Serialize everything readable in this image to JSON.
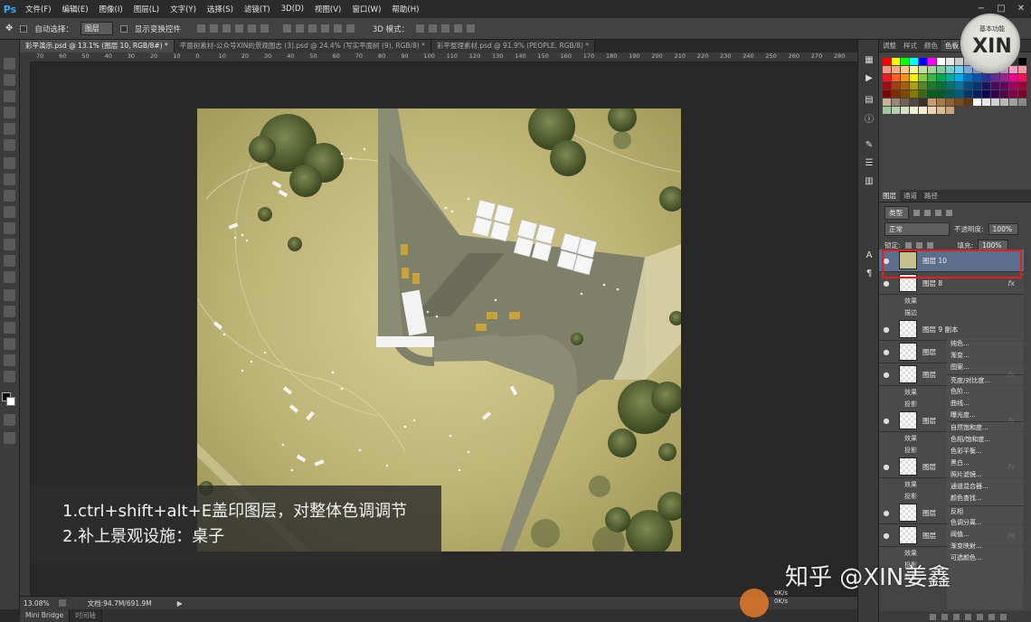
{
  "app": {
    "logo": "Ps"
  },
  "menu": [
    "文件(F)",
    "编辑(E)",
    "图像(I)",
    "图层(L)",
    "文字(Y)",
    "选择(S)",
    "滤镜(T)",
    "3D(D)",
    "视图(V)",
    "窗口(W)",
    "帮助(H)"
  ],
  "window_controls": [
    "−",
    "□",
    "✕"
  ],
  "options_bar": {
    "auto_select_label": "自动选择：",
    "auto_select_value": "图层",
    "show_transform_label": "显示变换控件",
    "mode_3d_label": "3D 模式：",
    "workspace": "基本功能"
  },
  "tabs": [
    {
      "label": "彩平演示.psd @ 13.1% (图层 10, RGB/8#) *",
      "active": true
    },
    {
      "label": "平面树素材-公众号XIN的景观图志 (3).psd @ 24.4% (写实平面树 (9), RGB/8) *",
      "active": false
    },
    {
      "label": "彩平整理素材.psd @ 91.9% (PEOPLE, RGB/8) *",
      "active": false
    }
  ],
  "ruler_ticks": [
    "70",
    "60",
    "50",
    "40",
    "30",
    "20",
    "10",
    "0",
    "10",
    "20",
    "30",
    "40",
    "50",
    "60",
    "70",
    "80",
    "90",
    "100",
    "110",
    "120",
    "130",
    "140",
    "150",
    "160",
    "170",
    "180",
    "190",
    "200",
    "210",
    "220",
    "230",
    "240",
    "250",
    "260",
    "270",
    "280"
  ],
  "subtitle": {
    "line1": "1.ctrl+shift+alt+E盖印图层，对整体色调调节",
    "line2": "2.补上景观设施：桌子"
  },
  "status": {
    "zoom": "13.08%",
    "doc": "文档:94.7M/691.9M"
  },
  "bottom_tabs": [
    "Mini Bridge",
    "时间轴"
  ],
  "swatch_panel": {
    "tabs": [
      "调整",
      "样式",
      "颜色",
      "色板"
    ]
  },
  "swatch_colors": [
    "#ff0000",
    "#ffff00",
    "#00ff00",
    "#00ffff",
    "#0000ff",
    "#ff00ff",
    "#ffffff",
    "#e6e6e6",
    "#cccccc",
    "#b3b3b3",
    "#999999",
    "#808080",
    "#666666",
    "#4d4d4d",
    "#333333",
    "#000000",
    "#f7977a",
    "#f9ad81",
    "#fdc68a",
    "#fff79a",
    "#c4df9b",
    "#a3d39c",
    "#82ca9d",
    "#7bcdc8",
    "#6ecff6",
    "#7ea7d8",
    "#8493ca",
    "#8882be",
    "#a187be",
    "#bc8dbf",
    "#f49ac2",
    "#f6989d",
    "#ed1c24",
    "#f26522",
    "#f7941d",
    "#fff200",
    "#8dc63f",
    "#39b54a",
    "#00a651",
    "#00a99d",
    "#00aeef",
    "#0072bc",
    "#0054a6",
    "#2e3192",
    "#662d91",
    "#92278f",
    "#ec008c",
    "#ed145b",
    "#9e0b0f",
    "#a0410d",
    "#a36209",
    "#aba000",
    "#598527",
    "#1a7b30",
    "#007236",
    "#00746b",
    "#0076a3",
    "#004b80",
    "#003471",
    "#1b1464",
    "#440e62",
    "#630460",
    "#9e005d",
    "#9e0039",
    "#790000",
    "#7b2e00",
    "#7d4900",
    "#827b00",
    "#406618",
    "#005e20",
    "#005826",
    "#005952",
    "#005b7f",
    "#003663",
    "#002157",
    "#0d004c",
    "#32004b",
    "#4b0049",
    "#7b0046",
    "#7a0026",
    "#c7b299",
    "#998675",
    "#736357",
    "#534741",
    "#37302d",
    "#c69c6d",
    "#a67c52",
    "#8c6239",
    "#754c24",
    "#603913",
    "#ffffff",
    "#e8e8e8",
    "#d0d0d0",
    "#b8b8b8",
    "#a0a0a0",
    "#888888",
    "#9fc7a0",
    "#b5d2b0",
    "#d6e3c4",
    "#eef0d6",
    "#f5ecd2",
    "#e9d7b9",
    "#d9bd97",
    "#c8a27a"
  ],
  "layers_panel": {
    "tabs": [
      "图层",
      "通道",
      "路径"
    ],
    "filter_kind": "类型",
    "blend_mode": "正常",
    "opacity_label": "不透明度:",
    "opacity_value": "100%",
    "lock_label": "锁定:",
    "fill_label": "填充:",
    "fill_value": "100%",
    "effects_label": "效果",
    "fx_label": "fx"
  },
  "layers": [
    {
      "name": "图层 10",
      "type": "layer",
      "selected": true,
      "thumb": "img",
      "fx": false
    },
    {
      "name": "图层 8",
      "type": "layer",
      "selected": false,
      "thumb": "checker",
      "fx": true
    },
    {
      "name": "效果",
      "type": "effect"
    },
    {
      "name": "描边",
      "type": "effect"
    },
    {
      "name": "图层 9 副本",
      "type": "layer",
      "selected": false,
      "thumb": "checker",
      "fx": false
    },
    {
      "name": "图层",
      "type": "layer",
      "selected": false,
      "thumb": "checker",
      "fx": false
    },
    {
      "name": "图层",
      "type": "layer",
      "selected": false,
      "thumb": "checker",
      "fx": true
    },
    {
      "name": "效果",
      "type": "effect"
    },
    {
      "name": "投影",
      "type": "effect"
    },
    {
      "name": "图层",
      "type": "layer",
      "selected": false,
      "thumb": "checker",
      "fx": true
    },
    {
      "name": "效果",
      "type": "effect"
    },
    {
      "name": "投影",
      "type": "effect"
    },
    {
      "name": "图层",
      "type": "layer",
      "selected": false,
      "thumb": "checker",
      "fx": true
    },
    {
      "name": "效果",
      "type": "effect"
    },
    {
      "name": "投影",
      "type": "effect"
    },
    {
      "name": "图层",
      "type": "layer",
      "selected": false,
      "thumb": "checker",
      "fx": false
    },
    {
      "name": "图层",
      "type": "layer",
      "selected": false,
      "thumb": "checker",
      "fx": true
    },
    {
      "name": "效果",
      "type": "effect"
    },
    {
      "name": "投影",
      "type": "effect"
    },
    {
      "name": "效果",
      "type": "effect"
    }
  ],
  "adjustment_menu": [
    "纯色...",
    "渐变...",
    "图案...",
    "亮度/对比度...",
    "色阶...",
    "曲线...",
    "曝光度...",
    "自然饱和度...",
    "色相/饱和度...",
    "色彩平衡...",
    "黑白...",
    "照片滤镜...",
    "通道混合器...",
    "颜色查找...",
    "反相",
    "色调分离...",
    "阈值...",
    "渐变映射...",
    "可选颜色..."
  ],
  "watermark": {
    "logo_top": "基本功能",
    "logo_main": "XIN",
    "zhihu": "知乎 @XIN姜鑫",
    "badge_lines": [
      "0K/s",
      "0K/s"
    ]
  }
}
